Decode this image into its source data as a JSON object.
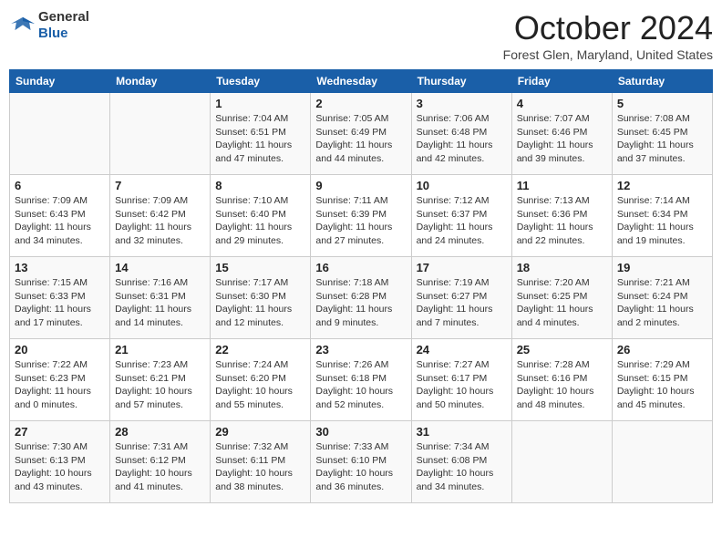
{
  "header": {
    "logo_general": "General",
    "logo_blue": "Blue",
    "month": "October 2024",
    "location": "Forest Glen, Maryland, United States"
  },
  "days_of_week": [
    "Sunday",
    "Monday",
    "Tuesday",
    "Wednesday",
    "Thursday",
    "Friday",
    "Saturday"
  ],
  "weeks": [
    [
      {
        "day": "",
        "info": ""
      },
      {
        "day": "",
        "info": ""
      },
      {
        "day": "1",
        "info": "Sunrise: 7:04 AM\nSunset: 6:51 PM\nDaylight: 11 hours and 47 minutes."
      },
      {
        "day": "2",
        "info": "Sunrise: 7:05 AM\nSunset: 6:49 PM\nDaylight: 11 hours and 44 minutes."
      },
      {
        "day": "3",
        "info": "Sunrise: 7:06 AM\nSunset: 6:48 PM\nDaylight: 11 hours and 42 minutes."
      },
      {
        "day": "4",
        "info": "Sunrise: 7:07 AM\nSunset: 6:46 PM\nDaylight: 11 hours and 39 minutes."
      },
      {
        "day": "5",
        "info": "Sunrise: 7:08 AM\nSunset: 6:45 PM\nDaylight: 11 hours and 37 minutes."
      }
    ],
    [
      {
        "day": "6",
        "info": "Sunrise: 7:09 AM\nSunset: 6:43 PM\nDaylight: 11 hours and 34 minutes."
      },
      {
        "day": "7",
        "info": "Sunrise: 7:09 AM\nSunset: 6:42 PM\nDaylight: 11 hours and 32 minutes."
      },
      {
        "day": "8",
        "info": "Sunrise: 7:10 AM\nSunset: 6:40 PM\nDaylight: 11 hours and 29 minutes."
      },
      {
        "day": "9",
        "info": "Sunrise: 7:11 AM\nSunset: 6:39 PM\nDaylight: 11 hours and 27 minutes."
      },
      {
        "day": "10",
        "info": "Sunrise: 7:12 AM\nSunset: 6:37 PM\nDaylight: 11 hours and 24 minutes."
      },
      {
        "day": "11",
        "info": "Sunrise: 7:13 AM\nSunset: 6:36 PM\nDaylight: 11 hours and 22 minutes."
      },
      {
        "day": "12",
        "info": "Sunrise: 7:14 AM\nSunset: 6:34 PM\nDaylight: 11 hours and 19 minutes."
      }
    ],
    [
      {
        "day": "13",
        "info": "Sunrise: 7:15 AM\nSunset: 6:33 PM\nDaylight: 11 hours and 17 minutes."
      },
      {
        "day": "14",
        "info": "Sunrise: 7:16 AM\nSunset: 6:31 PM\nDaylight: 11 hours and 14 minutes."
      },
      {
        "day": "15",
        "info": "Sunrise: 7:17 AM\nSunset: 6:30 PM\nDaylight: 11 hours and 12 minutes."
      },
      {
        "day": "16",
        "info": "Sunrise: 7:18 AM\nSunset: 6:28 PM\nDaylight: 11 hours and 9 minutes."
      },
      {
        "day": "17",
        "info": "Sunrise: 7:19 AM\nSunset: 6:27 PM\nDaylight: 11 hours and 7 minutes."
      },
      {
        "day": "18",
        "info": "Sunrise: 7:20 AM\nSunset: 6:25 PM\nDaylight: 11 hours and 4 minutes."
      },
      {
        "day": "19",
        "info": "Sunrise: 7:21 AM\nSunset: 6:24 PM\nDaylight: 11 hours and 2 minutes."
      }
    ],
    [
      {
        "day": "20",
        "info": "Sunrise: 7:22 AM\nSunset: 6:23 PM\nDaylight: 11 hours and 0 minutes."
      },
      {
        "day": "21",
        "info": "Sunrise: 7:23 AM\nSunset: 6:21 PM\nDaylight: 10 hours and 57 minutes."
      },
      {
        "day": "22",
        "info": "Sunrise: 7:24 AM\nSunset: 6:20 PM\nDaylight: 10 hours and 55 minutes."
      },
      {
        "day": "23",
        "info": "Sunrise: 7:26 AM\nSunset: 6:18 PM\nDaylight: 10 hours and 52 minutes."
      },
      {
        "day": "24",
        "info": "Sunrise: 7:27 AM\nSunset: 6:17 PM\nDaylight: 10 hours and 50 minutes."
      },
      {
        "day": "25",
        "info": "Sunrise: 7:28 AM\nSunset: 6:16 PM\nDaylight: 10 hours and 48 minutes."
      },
      {
        "day": "26",
        "info": "Sunrise: 7:29 AM\nSunset: 6:15 PM\nDaylight: 10 hours and 45 minutes."
      }
    ],
    [
      {
        "day": "27",
        "info": "Sunrise: 7:30 AM\nSunset: 6:13 PM\nDaylight: 10 hours and 43 minutes."
      },
      {
        "day": "28",
        "info": "Sunrise: 7:31 AM\nSunset: 6:12 PM\nDaylight: 10 hours and 41 minutes."
      },
      {
        "day": "29",
        "info": "Sunrise: 7:32 AM\nSunset: 6:11 PM\nDaylight: 10 hours and 38 minutes."
      },
      {
        "day": "30",
        "info": "Sunrise: 7:33 AM\nSunset: 6:10 PM\nDaylight: 10 hours and 36 minutes."
      },
      {
        "day": "31",
        "info": "Sunrise: 7:34 AM\nSunset: 6:08 PM\nDaylight: 10 hours and 34 minutes."
      },
      {
        "day": "",
        "info": ""
      },
      {
        "day": "",
        "info": ""
      }
    ]
  ]
}
